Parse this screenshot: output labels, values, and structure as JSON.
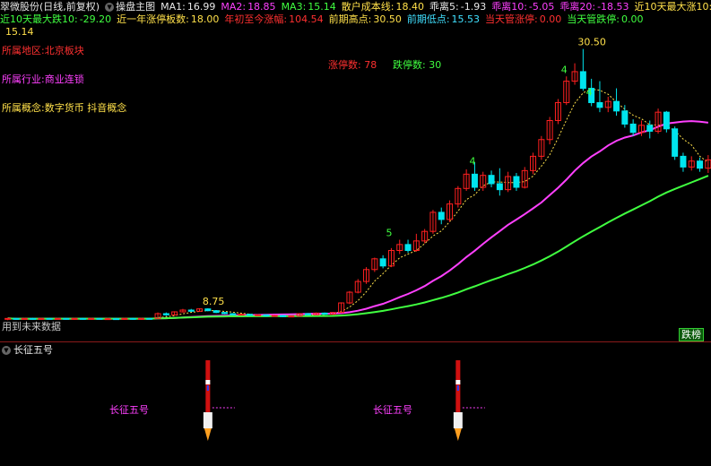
{
  "header": {
    "stock_title": "翠微股份(日线,前复权)",
    "main_chart_label": "操盘主图",
    "ma1_label": "MA1:",
    "ma1_value": "16.99",
    "ma2_label": "MA2:",
    "ma2_value": "18.85",
    "ma3_label": "MA3:",
    "ma3_value": "15.14",
    "cost_label": "散户成本线:",
    "cost_value": "18.40",
    "bias5_label": "乖离5:",
    "bias5_value": "-1.93",
    "bias10_label": "乖离10:",
    "bias10_value": "-5.05",
    "bias20_label": "乖离20:",
    "bias20_value": "-18.53",
    "max_rise10_label": "近10天最大涨10:",
    "max_rise10_value": "15.14",
    "max_fall10_label": "近10天最大跌10:",
    "max_fall10_value": "-29.20",
    "limit_up_year_label": "近一年涨停板数:",
    "limit_up_year_value": "18.00",
    "ytd_label": "年初至今涨幅:",
    "ytd_value": "104.54",
    "high_label": "前期高点:",
    "high_value": "30.50",
    "low_label": "前期低点:",
    "low_value": "15.53",
    "today_up_label": "当天管涨停:",
    "today_up_value": "0.00",
    "today_down_label": "当天管跌停:",
    "today_down_value": "0.00"
  },
  "info": {
    "region": "所属地区:北京板块",
    "industry": "所属行业:商业连锁",
    "concept": "所属概念:数字货币 抖音概念"
  },
  "counts": {
    "limit_up_label": "涨停数:",
    "limit_up_value": "78",
    "limit_down_label": "跌停数:",
    "limit_down_value": "30"
  },
  "footer_note": "用到未来数据",
  "badge": "跌榜",
  "sub_chart": {
    "title": "长征五号",
    "marker_label": "长征五号"
  },
  "chart_data": {
    "type": "candlestick",
    "title": "",
    "ylim": [
      8.0,
      31.0
    ],
    "annotations": [
      {
        "text": "8.75",
        "index": 24,
        "value": 8.75
      },
      {
        "text": "30.50",
        "index": 69,
        "value": 30.5
      },
      {
        "text": "5",
        "index": 46,
        "value": 14.5
      },
      {
        "text": "4",
        "index": 56,
        "value": 20.5
      },
      {
        "text": "4",
        "index": 67,
        "value": 28.2
      },
      {
        "text": "4",
        "index": 70,
        "value": 26.3
      }
    ],
    "candles": [
      [
        7.85,
        7.9,
        7.75,
        7.95
      ],
      [
        7.9,
        7.85,
        7.8,
        7.95
      ],
      [
        7.85,
        7.9,
        7.8,
        7.95
      ],
      [
        7.9,
        7.85,
        7.8,
        7.95
      ],
      [
        7.85,
        7.9,
        7.8,
        7.95
      ],
      [
        7.9,
        7.88,
        7.8,
        7.95
      ],
      [
        7.88,
        7.9,
        7.82,
        7.95
      ],
      [
        7.9,
        7.85,
        7.8,
        7.95
      ],
      [
        7.85,
        7.9,
        7.8,
        7.95
      ],
      [
        7.9,
        7.87,
        7.8,
        7.95
      ],
      [
        7.87,
        7.9,
        7.82,
        7.95
      ],
      [
        7.9,
        7.86,
        7.8,
        7.95
      ],
      [
        7.86,
        7.88,
        7.8,
        7.95
      ],
      [
        7.88,
        7.85,
        7.8,
        7.95
      ],
      [
        7.85,
        7.9,
        7.8,
        7.95
      ],
      [
        7.9,
        7.86,
        7.8,
        7.95
      ],
      [
        7.86,
        7.9,
        7.8,
        7.95
      ],
      [
        7.9,
        7.88,
        7.82,
        7.95
      ],
      [
        7.9,
        8.3,
        7.9,
        8.4
      ],
      [
        8.3,
        8.2,
        8.1,
        8.4
      ],
      [
        8.2,
        8.45,
        8.15,
        8.5
      ],
      [
        8.45,
        8.6,
        8.4,
        8.7
      ],
      [
        8.6,
        8.5,
        8.45,
        8.7
      ],
      [
        8.5,
        8.7,
        8.45,
        8.75
      ],
      [
        8.7,
        8.55,
        8.5,
        8.75
      ],
      [
        8.55,
        8.4,
        8.35,
        8.6
      ],
      [
        8.4,
        8.3,
        8.25,
        8.45
      ],
      [
        8.3,
        8.2,
        8.15,
        8.35
      ],
      [
        8.2,
        8.25,
        8.15,
        8.3
      ],
      [
        8.25,
        8.15,
        8.1,
        8.3
      ],
      [
        8.15,
        8.2,
        8.1,
        8.25
      ],
      [
        8.2,
        8.1,
        8.05,
        8.25
      ],
      [
        8.1,
        8.15,
        8.05,
        8.2
      ],
      [
        8.15,
        8.05,
        8.0,
        8.2
      ],
      [
        8.05,
        8.1,
        8.0,
        8.15
      ],
      [
        8.1,
        8.3,
        8.05,
        8.35
      ],
      [
        8.3,
        8.2,
        8.15,
        8.35
      ],
      [
        8.2,
        8.35,
        8.15,
        8.4
      ],
      [
        8.35,
        8.25,
        8.2,
        8.4
      ],
      [
        8.25,
        8.4,
        8.2,
        8.45
      ],
      [
        8.4,
        9.2,
        8.35,
        9.25
      ],
      [
        9.2,
        10.1,
        9.1,
        10.2
      ],
      [
        10.1,
        11.0,
        10.0,
        11.2
      ],
      [
        11.0,
        12.0,
        10.8,
        12.2
      ],
      [
        12.0,
        12.9,
        11.8,
        13.0
      ],
      [
        12.9,
        12.3,
        12.1,
        13.2
      ],
      [
        12.3,
        13.6,
        12.2,
        13.8
      ],
      [
        13.6,
        14.1,
        13.3,
        14.5
      ],
      [
        14.1,
        13.6,
        13.4,
        14.5
      ],
      [
        13.6,
        14.4,
        13.5,
        15.0
      ],
      [
        14.4,
        15.2,
        14.2,
        15.4
      ],
      [
        15.2,
        16.8,
        15.0,
        17.0
      ],
      [
        16.8,
        16.2,
        15.8,
        17.2
      ],
      [
        16.2,
        17.5,
        16.0,
        17.8
      ],
      [
        17.5,
        18.8,
        17.2,
        19.0
      ],
      [
        18.8,
        20.0,
        18.6,
        20.4
      ],
      [
        20.0,
        18.9,
        18.6,
        21.0
      ],
      [
        18.9,
        19.9,
        18.6,
        20.2
      ],
      [
        19.9,
        19.2,
        18.9,
        20.3
      ],
      [
        19.2,
        18.7,
        18.2,
        20.5
      ],
      [
        18.7,
        19.8,
        18.5,
        20.2
      ],
      [
        19.8,
        18.9,
        18.6,
        20.1
      ],
      [
        18.9,
        20.3,
        18.8,
        20.6
      ],
      [
        20.3,
        21.5,
        20.0,
        21.8
      ],
      [
        21.5,
        22.9,
        21.2,
        23.2
      ],
      [
        22.9,
        24.5,
        22.5,
        24.8
      ],
      [
        24.5,
        26.0,
        24.2,
        26.3
      ],
      [
        26.0,
        27.8,
        25.8,
        28.2
      ],
      [
        27.8,
        28.6,
        27.5,
        29.3
      ],
      [
        28.6,
        27.2,
        27.0,
        30.5
      ],
      [
        27.2,
        26.0,
        25.7,
        28.0
      ],
      [
        26.0,
        25.6,
        25.2,
        27.8
      ],
      [
        25.6,
        26.1,
        25.2,
        26.5
      ],
      [
        26.1,
        25.3,
        24.9,
        27.2
      ],
      [
        25.3,
        24.2,
        23.9,
        25.8
      ],
      [
        24.2,
        23.5,
        23.2,
        24.6
      ],
      [
        23.5,
        24.1,
        23.2,
        24.5
      ],
      [
        24.1,
        23.6,
        23.0,
        24.5
      ],
      [
        23.6,
        25.2,
        23.4,
        25.5
      ],
      [
        25.2,
        23.8,
        23.5,
        25.3
      ],
      [
        23.8,
        21.5,
        21.2,
        24.0
      ],
      [
        21.5,
        20.6,
        20.2,
        21.8
      ],
      [
        20.6,
        21.1,
        20.3,
        21.5
      ],
      [
        21.1,
        20.5,
        20.2,
        21.4
      ],
      [
        20.5,
        21.2,
        20.1,
        21.6
      ]
    ],
    "ma_series": [
      {
        "name": "MA1",
        "color": "#ffe04a",
        "style": "dotted"
      },
      {
        "name": "MA2",
        "color": "#ff40ff",
        "style": "solid"
      },
      {
        "name": "MA3",
        "color": "#40ff40",
        "style": "solid"
      }
    ],
    "signals": [
      24,
      54
    ]
  },
  "colors": {
    "up": "#ff2020",
    "down": "#00e5ee",
    "yellow": "#ffe04a",
    "magenta": "#ff40ff",
    "green": "#40ff40",
    "red_text": "#ff3030",
    "cyan_text": "#40e0ff"
  }
}
